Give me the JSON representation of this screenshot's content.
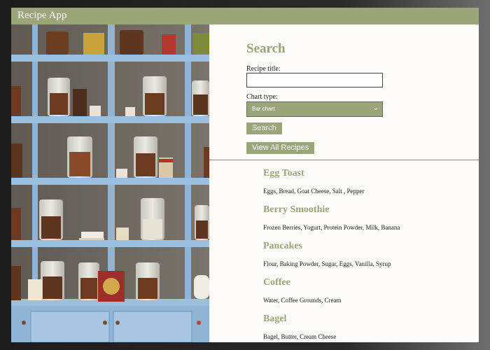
{
  "app": {
    "title": "Recipe App"
  },
  "search": {
    "heading": "Search",
    "title_label": "Recipe title:",
    "title_value": "",
    "chart_label": "Chart type:",
    "chart_value": "Bar chart",
    "search_button": "Search",
    "view_all_button": "View All Recipes"
  },
  "recipes": [
    {
      "name": "Egg Toast",
      "ingredients": "Eggs, Bread, Goat Cheese, Salt , Pepper"
    },
    {
      "name": "Berry Smoothie",
      "ingredients": "Frozen Berries, Yogurt, Protein Powder, Milk, Banana"
    },
    {
      "name": "Pancakes",
      "ingredients": "Flour, Baking Powder, Sugar, Eggs, Vanilla, Syrup"
    },
    {
      "name": "Coffee",
      "ingredients": "Water, Coffee Grounds, Cream"
    },
    {
      "name": "Bagel",
      "ingredients": "Bagel, Butter, Cream Cheese"
    }
  ],
  "colors": {
    "accent": "#9aa57a",
    "shelf": "#8fb4d6",
    "panel": "#fbfaf6"
  }
}
